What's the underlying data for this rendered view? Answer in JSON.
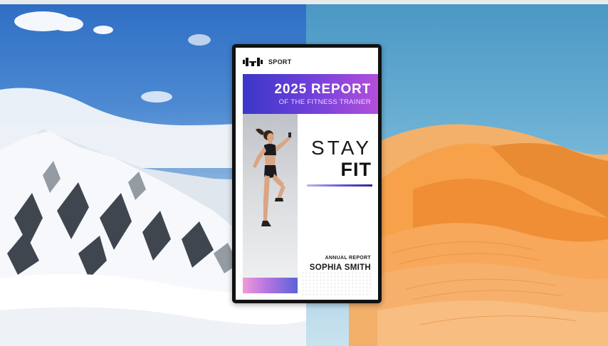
{
  "poster": {
    "brand": "SPORT",
    "banner_title": "2025 REPORT",
    "banner_subtitle": "OF THE FITNESS TRAINER",
    "headline_line1": "STAY",
    "headline_line2": "FIT",
    "report_label": "ANNUAL REPORT",
    "author": "SOPHIA SMITH",
    "icon": "dumbbell-icon"
  },
  "colors": {
    "banner_start": "#3a37c8",
    "banner_end": "#b44fdc",
    "accent_line": "#5e56d8",
    "strip_pink": "#f19ad6",
    "strip_blue": "#5b63d9",
    "desert_sand": "#f4a04a",
    "sky_blue": "#4a98c5"
  }
}
